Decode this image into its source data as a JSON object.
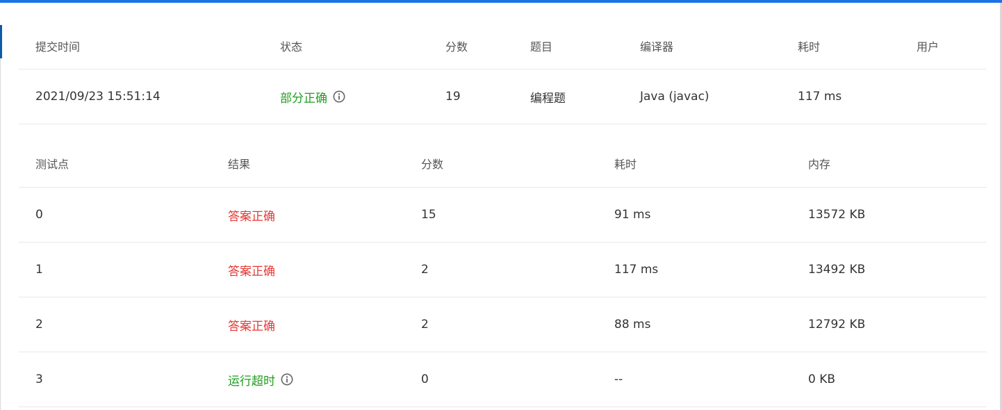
{
  "submission": {
    "headers": [
      "提交时间",
      "状态",
      "分数",
      "题目",
      "编译器",
      "耗时",
      "用户"
    ],
    "row": {
      "time": "2021/09/23 15:51:14",
      "status": "部分正确",
      "score": "19",
      "problem": "编程题",
      "compiler": "Java (javac)",
      "duration": "117 ms",
      "user": ""
    }
  },
  "tests": {
    "headers": [
      "测试点",
      "结果",
      "分数",
      "耗时",
      "内存"
    ],
    "rows": [
      {
        "id": "0",
        "result": "答案正确",
        "score": "15",
        "time": "91 ms",
        "memory": "13572 KB"
      },
      {
        "id": "1",
        "result": "答案正确",
        "score": "2",
        "time": "117 ms",
        "memory": "13492 KB"
      },
      {
        "id": "2",
        "result": "答案正确",
        "score": "2",
        "time": "88 ms",
        "memory": "12792 KB"
      },
      {
        "id": "3",
        "result": "运行超时",
        "score": "0",
        "time": "--",
        "memory": "0 KB"
      }
    ]
  },
  "colors": {
    "accent": "#1a73e8",
    "success": "#1e9e1e",
    "correct_text": "#e53935"
  },
  "icons": {
    "status_info": "info-circle-icon",
    "timeout_info": "info-circle-icon"
  }
}
